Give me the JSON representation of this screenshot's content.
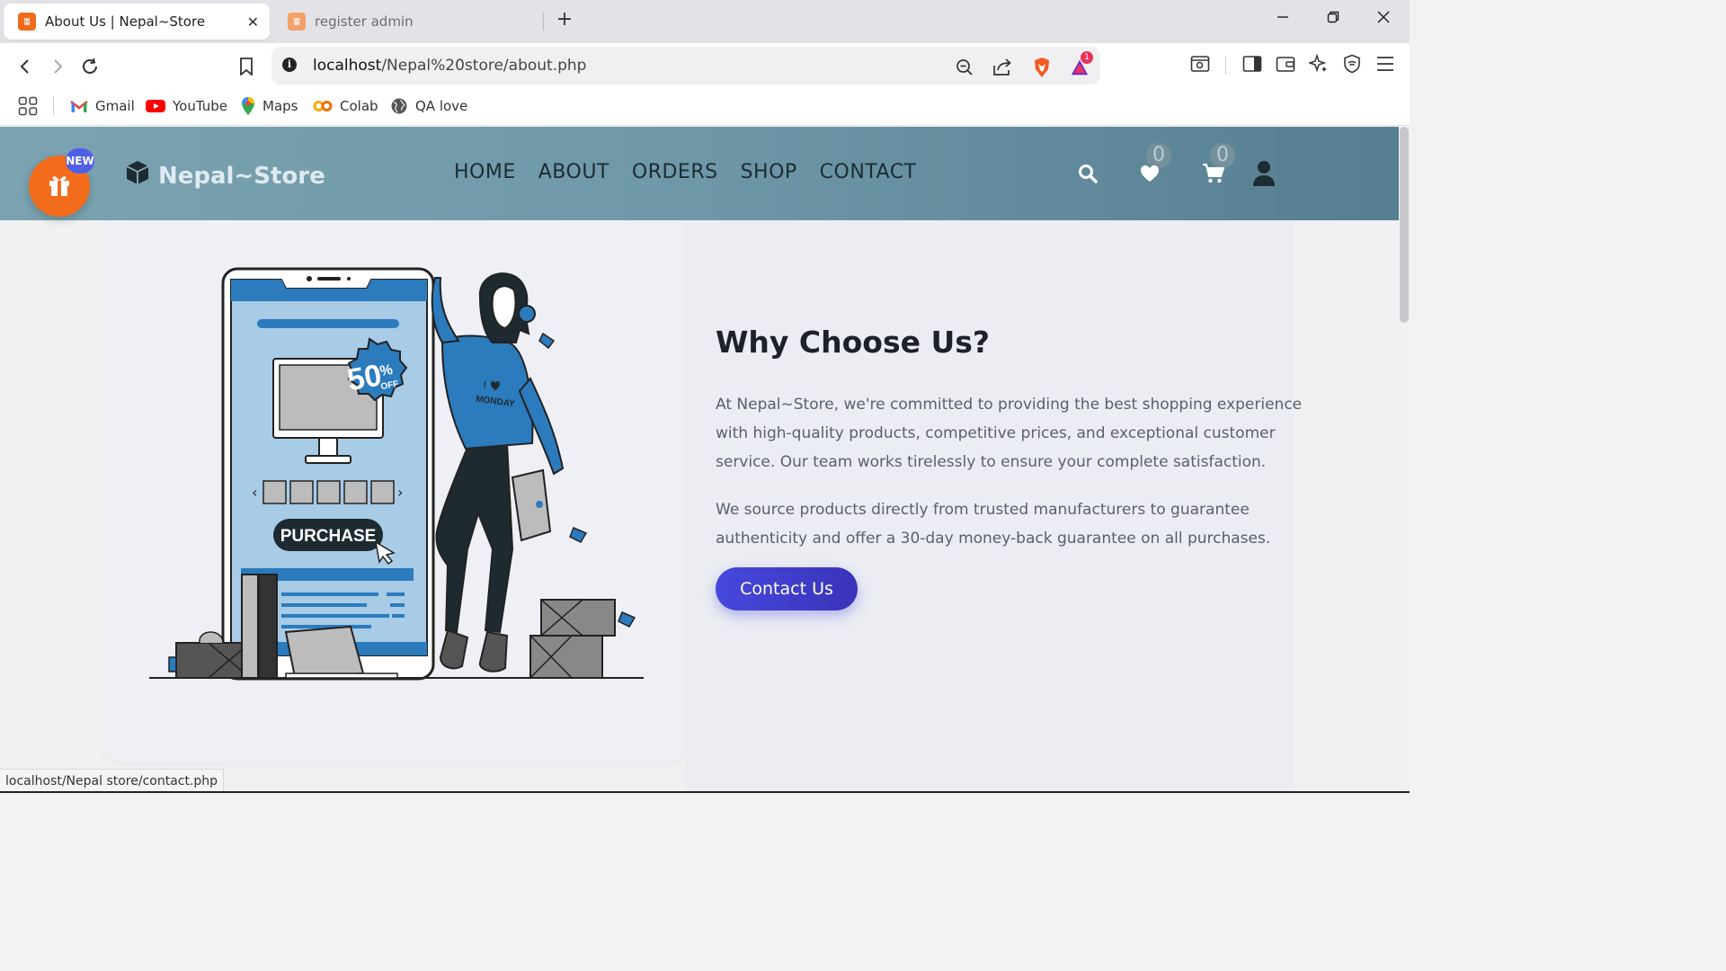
{
  "browser": {
    "tabs": [
      {
        "label": "About Us | Nepal~Store",
        "active": true
      },
      {
        "label": "register admin",
        "active": false
      }
    ],
    "new_tab_symbol": "+",
    "url": {
      "host": "localhost",
      "path": "/Nepal%20store/about.php"
    },
    "bookmarks": [
      {
        "label": "Gmail",
        "icon": "gmail-icon"
      },
      {
        "label": "YouTube",
        "icon": "youtube-icon"
      },
      {
        "label": "Maps",
        "icon": "maps-icon"
      },
      {
        "label": "Colab",
        "icon": "colab-icon"
      },
      {
        "label": "QA love",
        "icon": "globe-icon"
      }
    ],
    "shields_count": "1",
    "status_url": "localhost/Nepal store/contact.php"
  },
  "site": {
    "logo_text": "Nepal~Store",
    "new_badge": "NEW",
    "nav": [
      "HOME",
      "ABOUT",
      "ORDERS",
      "SHOP",
      "CONTACT"
    ],
    "wishlist_count": "0",
    "cart_count": "0"
  },
  "about": {
    "heading": "Why Choose Us?",
    "para1": "At Nepal~Store, we're committed to providing the best shopping experience with high-quality products, competitive prices, and exceptional customer service. Our team works tirelessly to ensure your complete satisfaction.",
    "para2": "We source products directly from trusted manufacturers to guarantee authenticity and offer a 30-day money-back guarantee on all purchases.",
    "cta": "Contact Us"
  },
  "illustration": {
    "discount_big": "50",
    "discount_pct": "%",
    "discount_off": "OFF",
    "purchase_label": "PURCHASE",
    "shirt_line1": "I",
    "shirt_line2": "MONDAY"
  },
  "colors": {
    "accent": "#4648de",
    "header_start": "#7ba3b1",
    "header_end": "#557f91",
    "gift": "#f36c1b",
    "illustration_blue": "#2b7bbd"
  }
}
